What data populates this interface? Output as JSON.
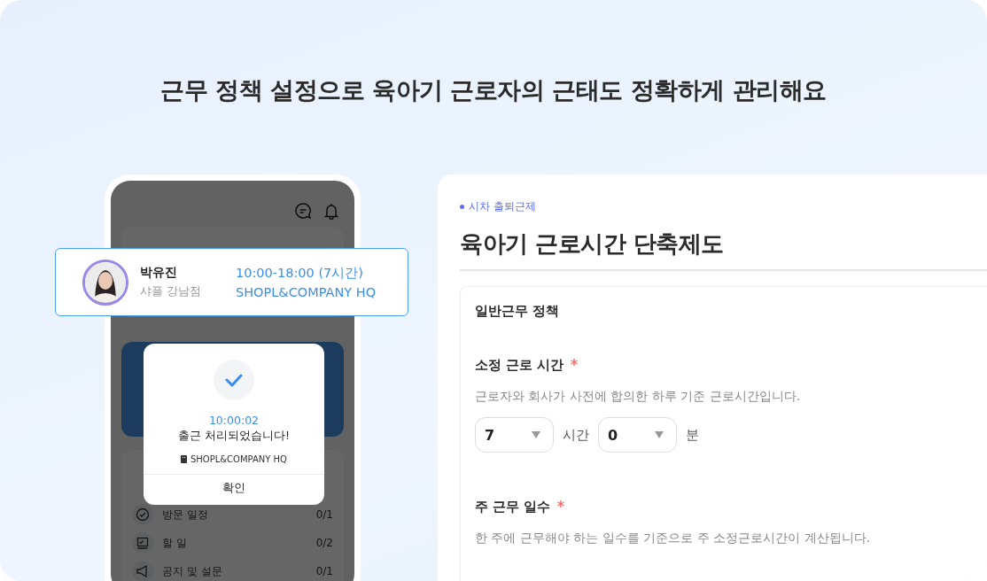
{
  "headline": "근무 정책 설정으로 육아기 근로자의 근태도 정확하게 관리해요",
  "phone": {
    "schedule_items": [
      {
        "label": "방문 일정",
        "count": "0/1"
      },
      {
        "label": "할 일",
        "count": "0/2"
      },
      {
        "label": "공지 및 설문",
        "count": "0/1"
      }
    ],
    "dialog": {
      "time": "10:00:02",
      "message": "출근 처리되었습니다!",
      "location": "SHOPL&COMPANY HQ",
      "confirm": "확인"
    }
  },
  "employee_card": {
    "name": "박유진",
    "store": "샤플 강남점",
    "hours": "10:00-18:00 (7시간)",
    "location": "SHOPL&COMPANY HQ"
  },
  "policy": {
    "tag": "시차 출퇴근제",
    "title": "육아기 근로시간 단축제도",
    "section": "일반근무 정책",
    "fields": [
      {
        "kind": "time",
        "label": "소정 근로 시간",
        "required": true,
        "help": "근로자와 회사가 사전에 합의한 하루 기준 근로시간입니다.",
        "hours": "7",
        "hours_unit": "시간",
        "minutes": "0",
        "minutes_unit": "분"
      },
      {
        "kind": "text",
        "label": "주 근무 일수",
        "required": true,
        "help": "한 주에 근무해야 하는 일수를 기준으로 주 소정근로시간이 계산됩니다."
      }
    ]
  }
}
